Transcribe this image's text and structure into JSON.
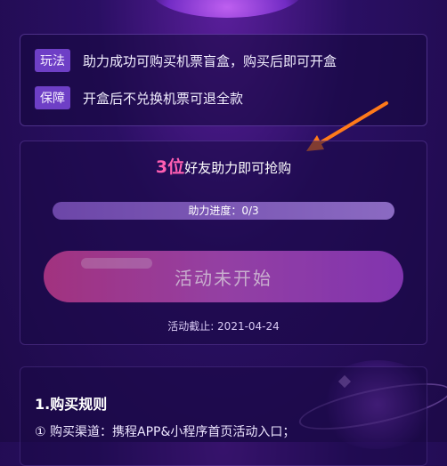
{
  "rules": [
    {
      "tag": "玩法",
      "text": "助力成功可购买机票盲盒，购买后即可开盒"
    },
    {
      "tag": "保障",
      "text": "开盒后不兑换机票可退全款"
    }
  ],
  "helpers": {
    "count": "3位",
    "text": "好友助力即可抢购"
  },
  "progress": {
    "label": "助力进度：0/3",
    "fraction": 0
  },
  "start_button": {
    "label": "活动未开始"
  },
  "deadline": "活动截止: 2021-04-24",
  "purchase_rules": {
    "title": "1.购买规则",
    "item": "① 购买渠道：携程APP&小程序首页活动入口；"
  }
}
